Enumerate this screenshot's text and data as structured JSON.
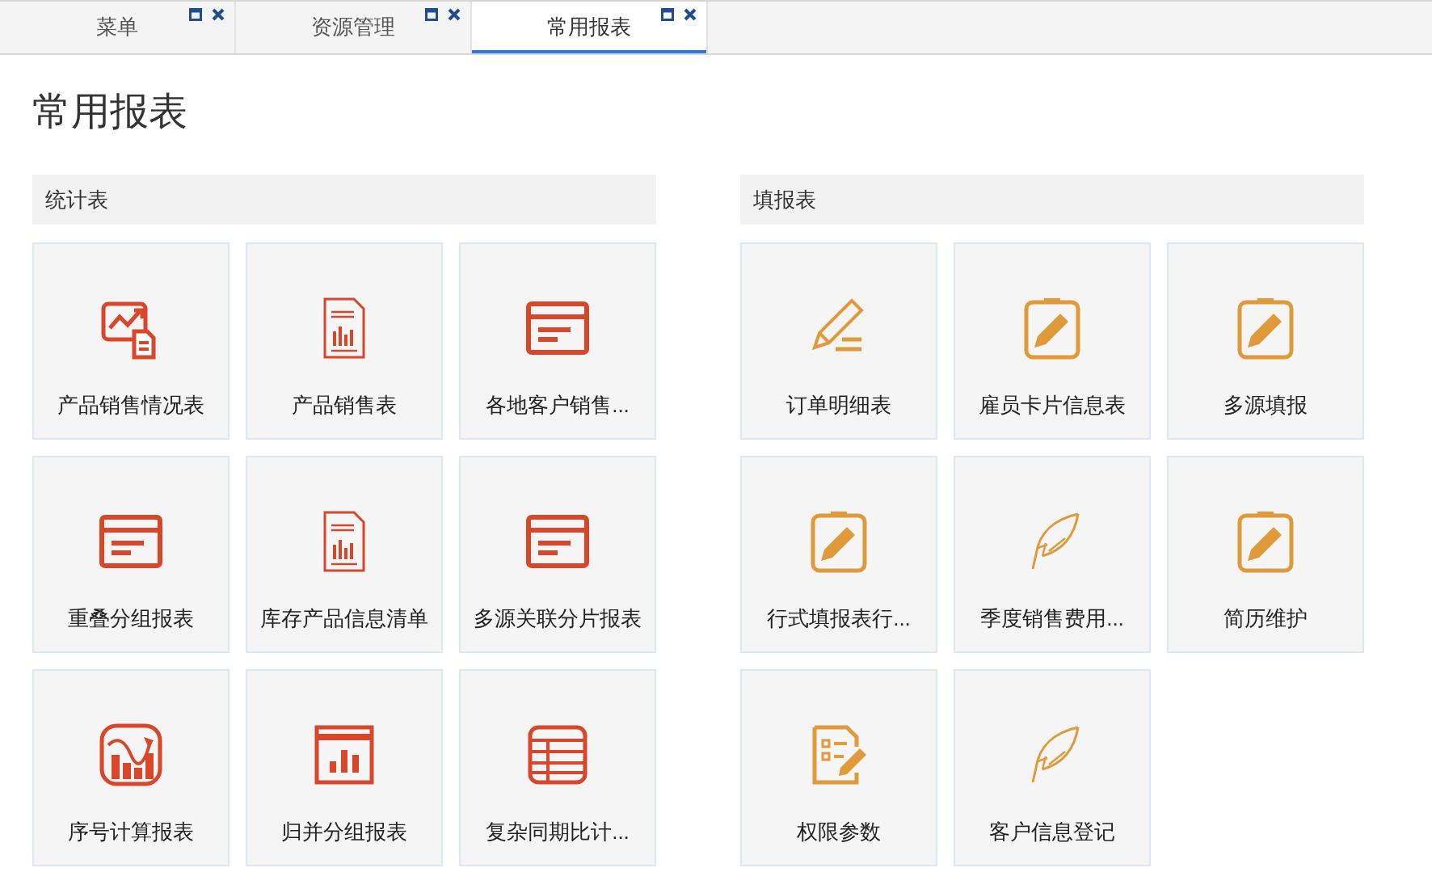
{
  "tabs": [
    {
      "label": "菜单",
      "selected": false
    },
    {
      "label": "资源管理",
      "selected": false
    },
    {
      "label": "常用报表",
      "selected": true
    }
  ],
  "page_title": "常用报表",
  "sections": [
    {
      "title": "统计表",
      "items": [
        {
          "label": "产品销售情况表",
          "kind": "chart-doc"
        },
        {
          "label": "产品销售表",
          "kind": "bar-doc"
        },
        {
          "label": "各地客户销售...",
          "kind": "window"
        },
        {
          "label": "重叠分组报表",
          "kind": "window"
        },
        {
          "label": "库存产品信息清单",
          "kind": "bar-doc"
        },
        {
          "label": "多源关联分片报表",
          "kind": "window"
        },
        {
          "label": "序号计算报表",
          "kind": "trend"
        },
        {
          "label": "归并分组报表",
          "kind": "window-bars"
        },
        {
          "label": "复杂同期比计...",
          "kind": "grid"
        }
      ]
    },
    {
      "title": "填报表",
      "items": [
        {
          "label": "订单明细表",
          "kind": "pencil-line"
        },
        {
          "label": "雇员卡片信息表",
          "kind": "clipboard"
        },
        {
          "label": "多源填报",
          "kind": "clipboard"
        },
        {
          "label": "行式填报表行...",
          "kind": "clipboard"
        },
        {
          "label": "季度销售费用...",
          "kind": "feather"
        },
        {
          "label": "简历维护",
          "kind": "clipboard"
        },
        {
          "label": "权限参数",
          "kind": "form"
        },
        {
          "label": "客户信息登记",
          "kind": "feather"
        }
      ]
    }
  ]
}
